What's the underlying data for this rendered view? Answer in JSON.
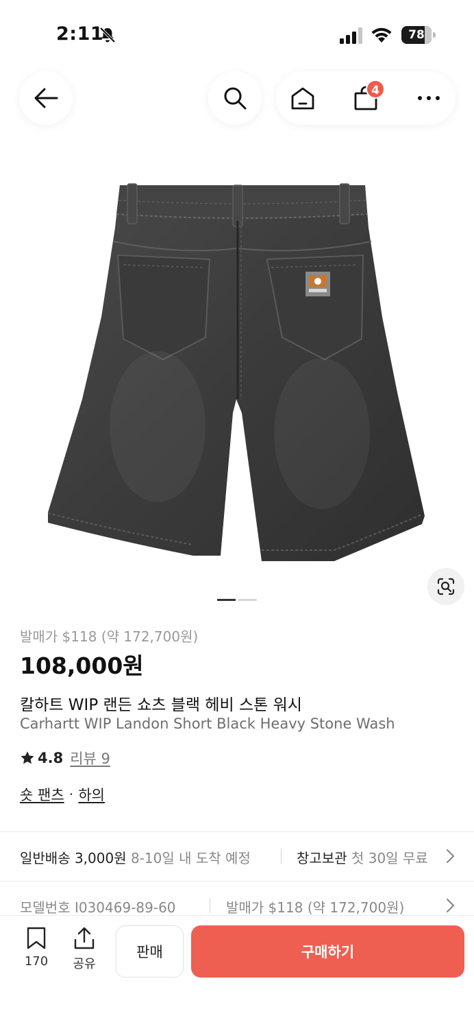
{
  "status_bar": {
    "time": "2:11",
    "battery": "78",
    "battery_level": 0.78
  },
  "nav": {
    "cart_count": "4",
    "icons": [
      "arrow-left-icon",
      "search-icon",
      "home-icon",
      "shopping-bag-icon",
      "more-icon"
    ]
  },
  "gallery": {
    "image_alt": "Carhartt WIP Landon Short Black Heavy Stone Wash",
    "page_current": 1,
    "page_total": 2
  },
  "product": {
    "release_price": "발매가 $118 (약 172,700원)",
    "price": "108,000원",
    "title_ko": "칼하트 WIP 랜든 쇼츠 블랙 헤비 스톤 워시",
    "title_en": "Carhartt WIP Landon Short Black Heavy Stone Wash",
    "rating": "4.8",
    "review_link": "리뷰 9",
    "category_1": "숏 팬츠",
    "category_sep": "·",
    "category_2": "하의"
  },
  "shipping": {
    "standard_label": "일반배송 3,000원",
    "standard_eta": "8-10일 내 도착 예정",
    "storage_label": "창고보관",
    "storage_note": "첫 30일 무료"
  },
  "model": {
    "model_number": "모델번호 I030469-89-60",
    "release_price": "발매가 $118 (약 172,700원)"
  },
  "bottom_bar": {
    "bookmark_count": "170",
    "share_label": "공유",
    "sell_label": "판매",
    "buy_label": "구매하기"
  },
  "colors": {
    "accent": "#ef5f51",
    "badge": "#ef5a4a"
  }
}
